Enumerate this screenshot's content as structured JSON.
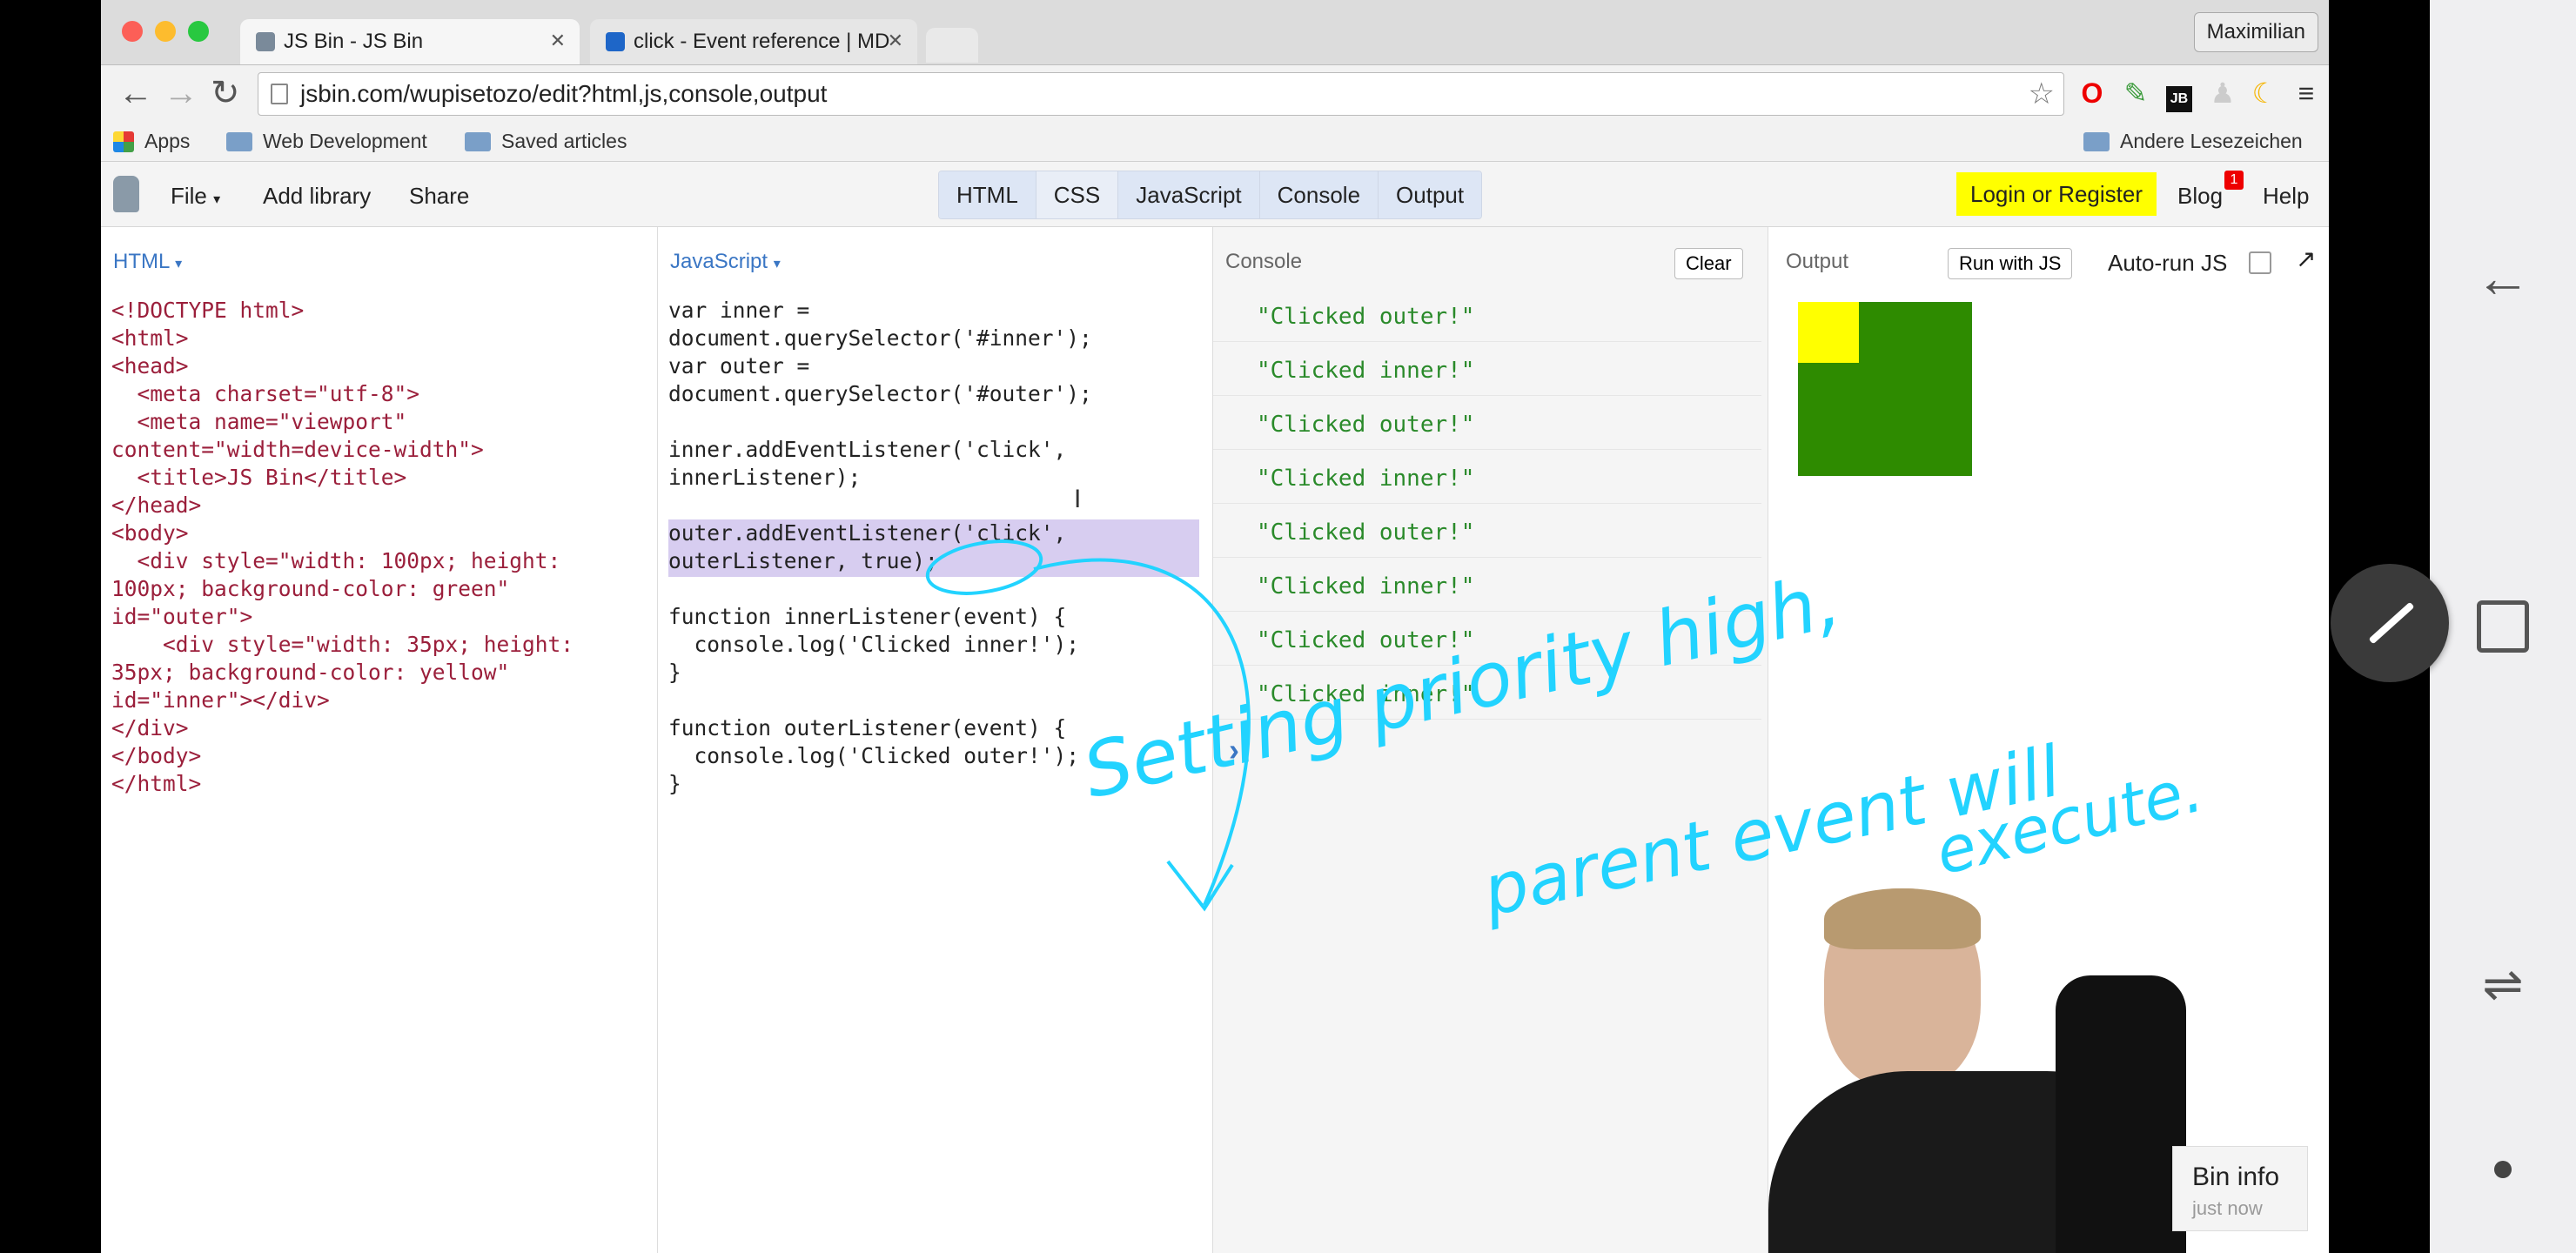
{
  "browser": {
    "tabs": [
      {
        "title": "JS Bin - JS Bin",
        "active": true
      },
      {
        "title": "click - Event reference | MDN",
        "active": false
      }
    ],
    "profile": "Maximilian",
    "url_host": "jsbin.com",
    "url_path": "/wupisetozo/edit?html,js,console,output",
    "bookmarks": [
      "Apps",
      "Web Development",
      "Saved articles"
    ],
    "other_bookmarks": "Andere Lesezeichen"
  },
  "jsbin": {
    "menu": [
      "File",
      "Add library",
      "Share"
    ],
    "panel_tabs": [
      "HTML",
      "CSS",
      "JavaScript",
      "Console",
      "Output"
    ],
    "login": "Login or Register",
    "blog": "Blog",
    "blog_badge": "1",
    "help": "Help",
    "html_label": "HTML",
    "js_label": "JavaScript",
    "console_label": "Console",
    "clear_label": "Clear",
    "output_label": "Output",
    "run_label": "Run with JS",
    "autorun_label": "Auto-run JS",
    "bin_info_title": "Bin info",
    "bin_info_time": "just now"
  },
  "html_code": "<!DOCTYPE html>\n<html>\n<head>\n  <meta charset=\"utf-8\">\n  <meta name=\"viewport\"\ncontent=\"width=device-width\">\n  <title>JS Bin</title>\n</head>\n<body>\n  <div style=\"width: 100px; height:\n100px; background-color: green\"\nid=\"outer\">\n    <div style=\"width: 35px; height:\n35px; background-color: yellow\"\nid=\"inner\"></div>\n</div>\n</body>\n</html>",
  "js_code": "var inner =\ndocument.querySelector('#inner');\nvar outer =\ndocument.querySelector('#outer');\n\ninner.addEventListener('click',\ninnerListener);\n\nouter.addEventListener('click',\nouterListener, true);\n\nfunction innerListener(event) {\n  console.log('Clicked inner!');\n}\n\nfunction outerListener(event) {\n  console.log('Clicked outer!');\n}",
  "console_lines": [
    "\"Clicked outer!\"",
    "\"Clicked inner!\"",
    "\"Clicked outer!\"",
    "\"Clicked inner!\"",
    "\"Clicked outer!\"",
    "\"Clicked inner!\"",
    "\"Clicked outer!\"",
    "\"Clicked inner!\""
  ],
  "console_prompt": "›",
  "annotation": {
    "line1": "Setting priority high,",
    "line2": "parent event will",
    "line3": "execute."
  },
  "colors": {
    "outer_box": "#2e8b00",
    "inner_box": "#ffff00",
    "annotation": "#22d3ff",
    "highlight": "#ffff00"
  }
}
